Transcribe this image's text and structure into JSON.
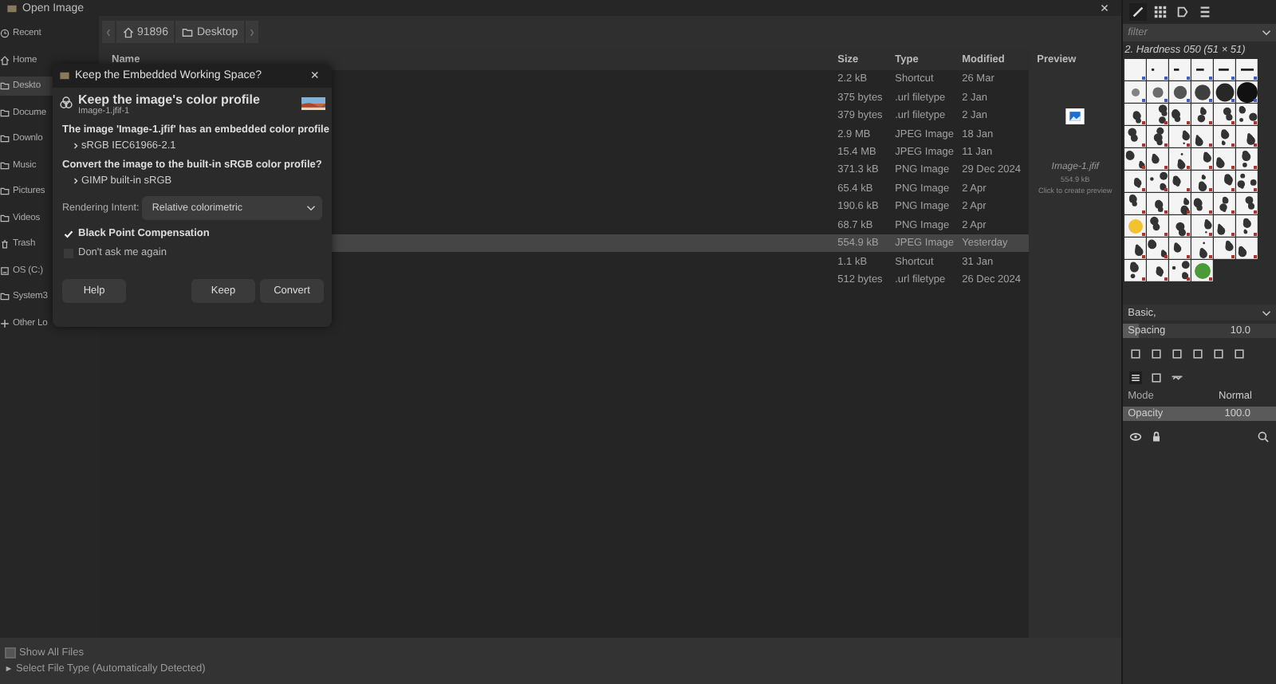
{
  "window": {
    "title": "Open Image",
    "close": "×"
  },
  "sidebar": {
    "items": [
      {
        "label": "Recent",
        "selected": false
      },
      {
        "label": "Home",
        "selected": false
      },
      {
        "label": "Deskto",
        "selected": true
      },
      {
        "label": "Docume",
        "selected": false
      },
      {
        "label": "Downlo",
        "selected": false
      },
      {
        "label": "Music",
        "selected": false
      },
      {
        "label": "Pictures",
        "selected": false
      },
      {
        "label": "Videos",
        "selected": false
      },
      {
        "label": "Trash",
        "selected": false
      },
      {
        "label": "OS (C:)",
        "selected": false
      },
      {
        "label": "System3",
        "selected": false
      },
      {
        "label": "Other Lo",
        "selected": false
      }
    ]
  },
  "path": [
    "91896",
    "Desktop"
  ],
  "table": {
    "columns": [
      "Name",
      "Size",
      "Type",
      "Modified"
    ],
    "rows": [
      {
        "size": "2.2 kB",
        "type": "Shortcut",
        "modified": "26 Mar",
        "selected": false
      },
      {
        "size": "375 bytes",
        "type": ".url filetype",
        "modified": "2 Jan",
        "selected": false
      },
      {
        "size": "379 bytes",
        "type": ".url filetype",
        "modified": "2 Jan",
        "selected": false
      },
      {
        "size": "2.9 MB",
        "type": "JPEG Image",
        "modified": "18 Jan",
        "selected": false
      },
      {
        "size": "15.4 MB",
        "type": "JPEG Image",
        "modified": "11 Jan",
        "selected": false
      },
      {
        "size": "371.3 kB",
        "type": "PNG Image",
        "modified": "29 Dec 2024",
        "selected": false
      },
      {
        "size": "65.4 kB",
        "type": "PNG Image",
        "modified": "2 Apr",
        "selected": false
      },
      {
        "size": "190.6 kB",
        "type": "PNG Image",
        "modified": "2 Apr",
        "selected": false
      },
      {
        "size": "68.7 kB",
        "type": "PNG Image",
        "modified": "2 Apr",
        "selected": false
      },
      {
        "size": "554.9 kB",
        "type": "JPEG Image",
        "modified": "Yesterday",
        "selected": true
      },
      {
        "size": "1.1 kB",
        "type": "Shortcut",
        "modified": "31 Jan",
        "selected": false
      },
      {
        "size": "512 bytes",
        "type": ".url filetype",
        "modified": "26 Dec 2024",
        "selected": false
      }
    ]
  },
  "preview": {
    "title": "Preview",
    "filename": "Image-1.jfif",
    "size": "554.9 kB",
    "hint": "Click to create preview"
  },
  "bottom": {
    "show_all": {
      "label": "Show All Files",
      "checked": false
    },
    "file_type": "Select File Type (Automatically Detected)"
  },
  "dialog": {
    "title": "Keep the Embedded Working Space?",
    "close": "×",
    "heading": "Keep the image's color profile",
    "subheading": "Image-1.jfif-1",
    "embedded_text": "The image 'Image-1.jfif' has an embedded color profile",
    "embedded_profile": "sRGB IEC61966-2.1",
    "convert_text": "Convert the image to the built-in sRGB color profile?",
    "builtin_profile": "GIMP built-in sRGB",
    "intent_label": "Rendering Intent:",
    "intent_value": "Relative colorimetric",
    "checkboxes": [
      {
        "label": "Black Point Compensation",
        "checked": true
      },
      {
        "label": "Don't ask me again",
        "checked": false
      }
    ],
    "buttons": [
      "Help",
      "Keep",
      "Convert"
    ]
  },
  "dock": {
    "filter_placeholder": "filter",
    "brush_name": "2. Hardness 050 (51 × 51)",
    "preset": "Basic,",
    "spacing": {
      "label": "Spacing",
      "value": "10.0",
      "level": 0.1
    },
    "mode": {
      "label": "Mode",
      "value": "Normal"
    },
    "opacity": {
      "label": "Opacity",
      "value": "100.0",
      "level": 1.0
    }
  }
}
